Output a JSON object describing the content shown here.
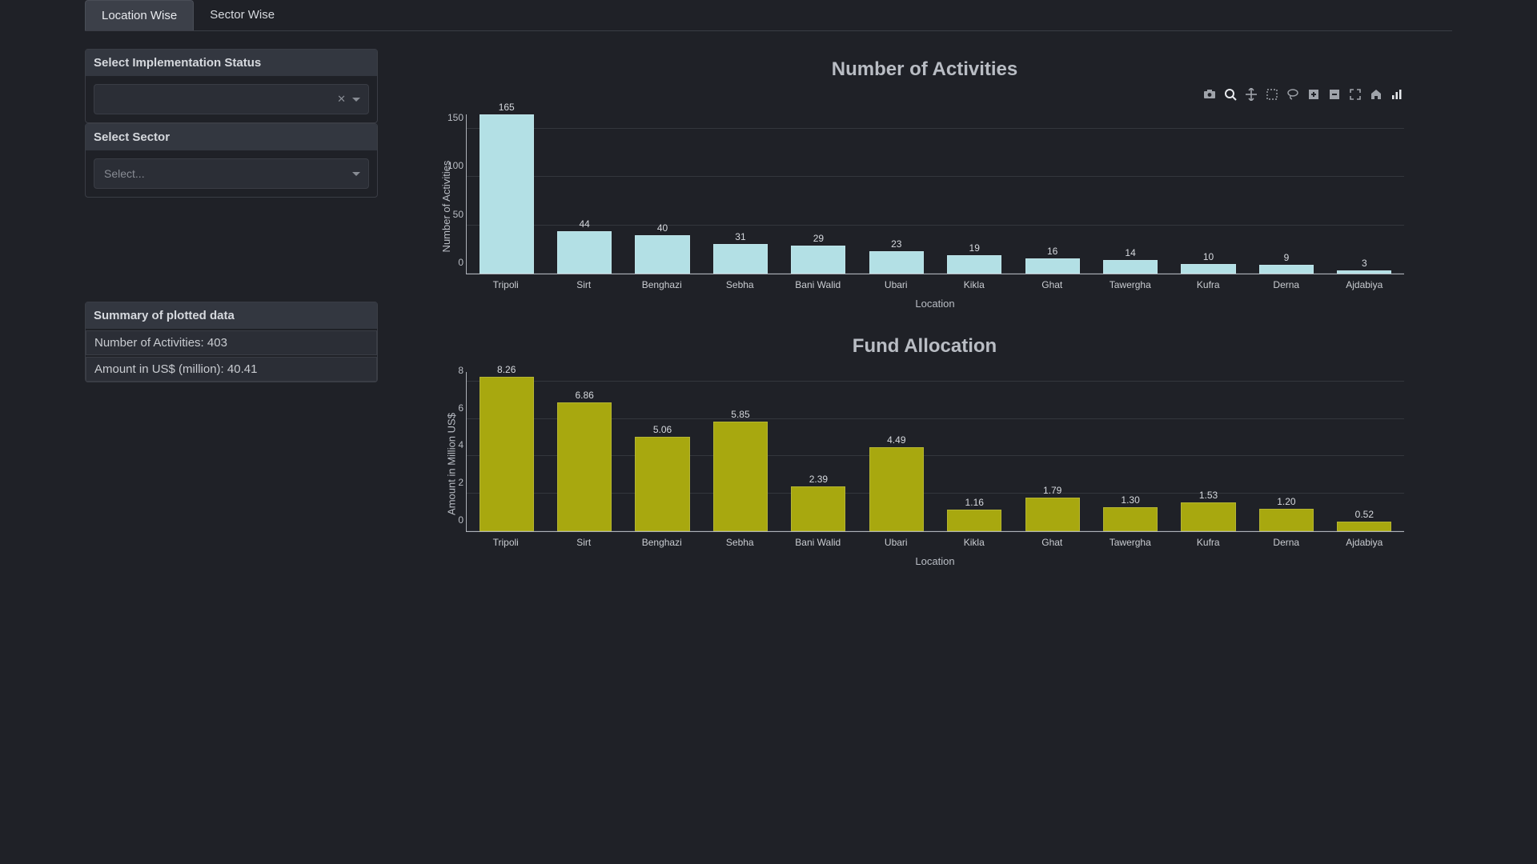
{
  "tabs": {
    "location": "Location Wise",
    "sector": "Sector Wise"
  },
  "filters": {
    "status_label": "Select Implementation Status",
    "sector_label": "Select Sector",
    "sector_placeholder": "Select..."
  },
  "summary": {
    "header": "Summary of plotted data",
    "activities_label": "Number of Activities: ",
    "activities_value": "403",
    "amount_label": "Amount in US$ (million): ",
    "amount_value": "40.41"
  },
  "toolbar_icons": [
    "camera",
    "zoom",
    "pan",
    "box-select",
    "lasso",
    "zoom-in",
    "zoom-out",
    "autoscale",
    "reset",
    "plotly-logo"
  ],
  "chart_data": [
    {
      "type": "bar",
      "title": "Number of Activities",
      "xlabel": "Location",
      "ylabel": "Number of Activities",
      "ylim": [
        0,
        165
      ],
      "y_ticks": [
        0,
        50,
        100,
        150
      ],
      "categories": [
        "Tripoli",
        "Sirt",
        "Benghazi",
        "Sebha",
        "Bani Walid",
        "Ubari",
        "Kikla",
        "Ghat",
        "Tawergha",
        "Kufra",
        "Derna",
        "Ajdabiya"
      ],
      "values": [
        165,
        44,
        40,
        31,
        29,
        23,
        19,
        16,
        14,
        10,
        9,
        3
      ],
      "color": "blue"
    },
    {
      "type": "bar",
      "title": "Fund Allocation",
      "xlabel": "Location",
      "ylabel": "Amount in Million US$",
      "ylim": [
        0,
        8.5
      ],
      "y_ticks": [
        0,
        2,
        4,
        6,
        8
      ],
      "categories": [
        "Tripoli",
        "Sirt",
        "Benghazi",
        "Sebha",
        "Bani Walid",
        "Ubari",
        "Kikla",
        "Ghat",
        "Tawergha",
        "Kufra",
        "Derna",
        "Ajdabiya"
      ],
      "values": [
        8.26,
        6.86,
        5.06,
        5.85,
        2.39,
        4.49,
        1.16,
        1.79,
        1.3,
        1.53,
        1.2,
        0.52
      ],
      "color": "olive"
    }
  ]
}
